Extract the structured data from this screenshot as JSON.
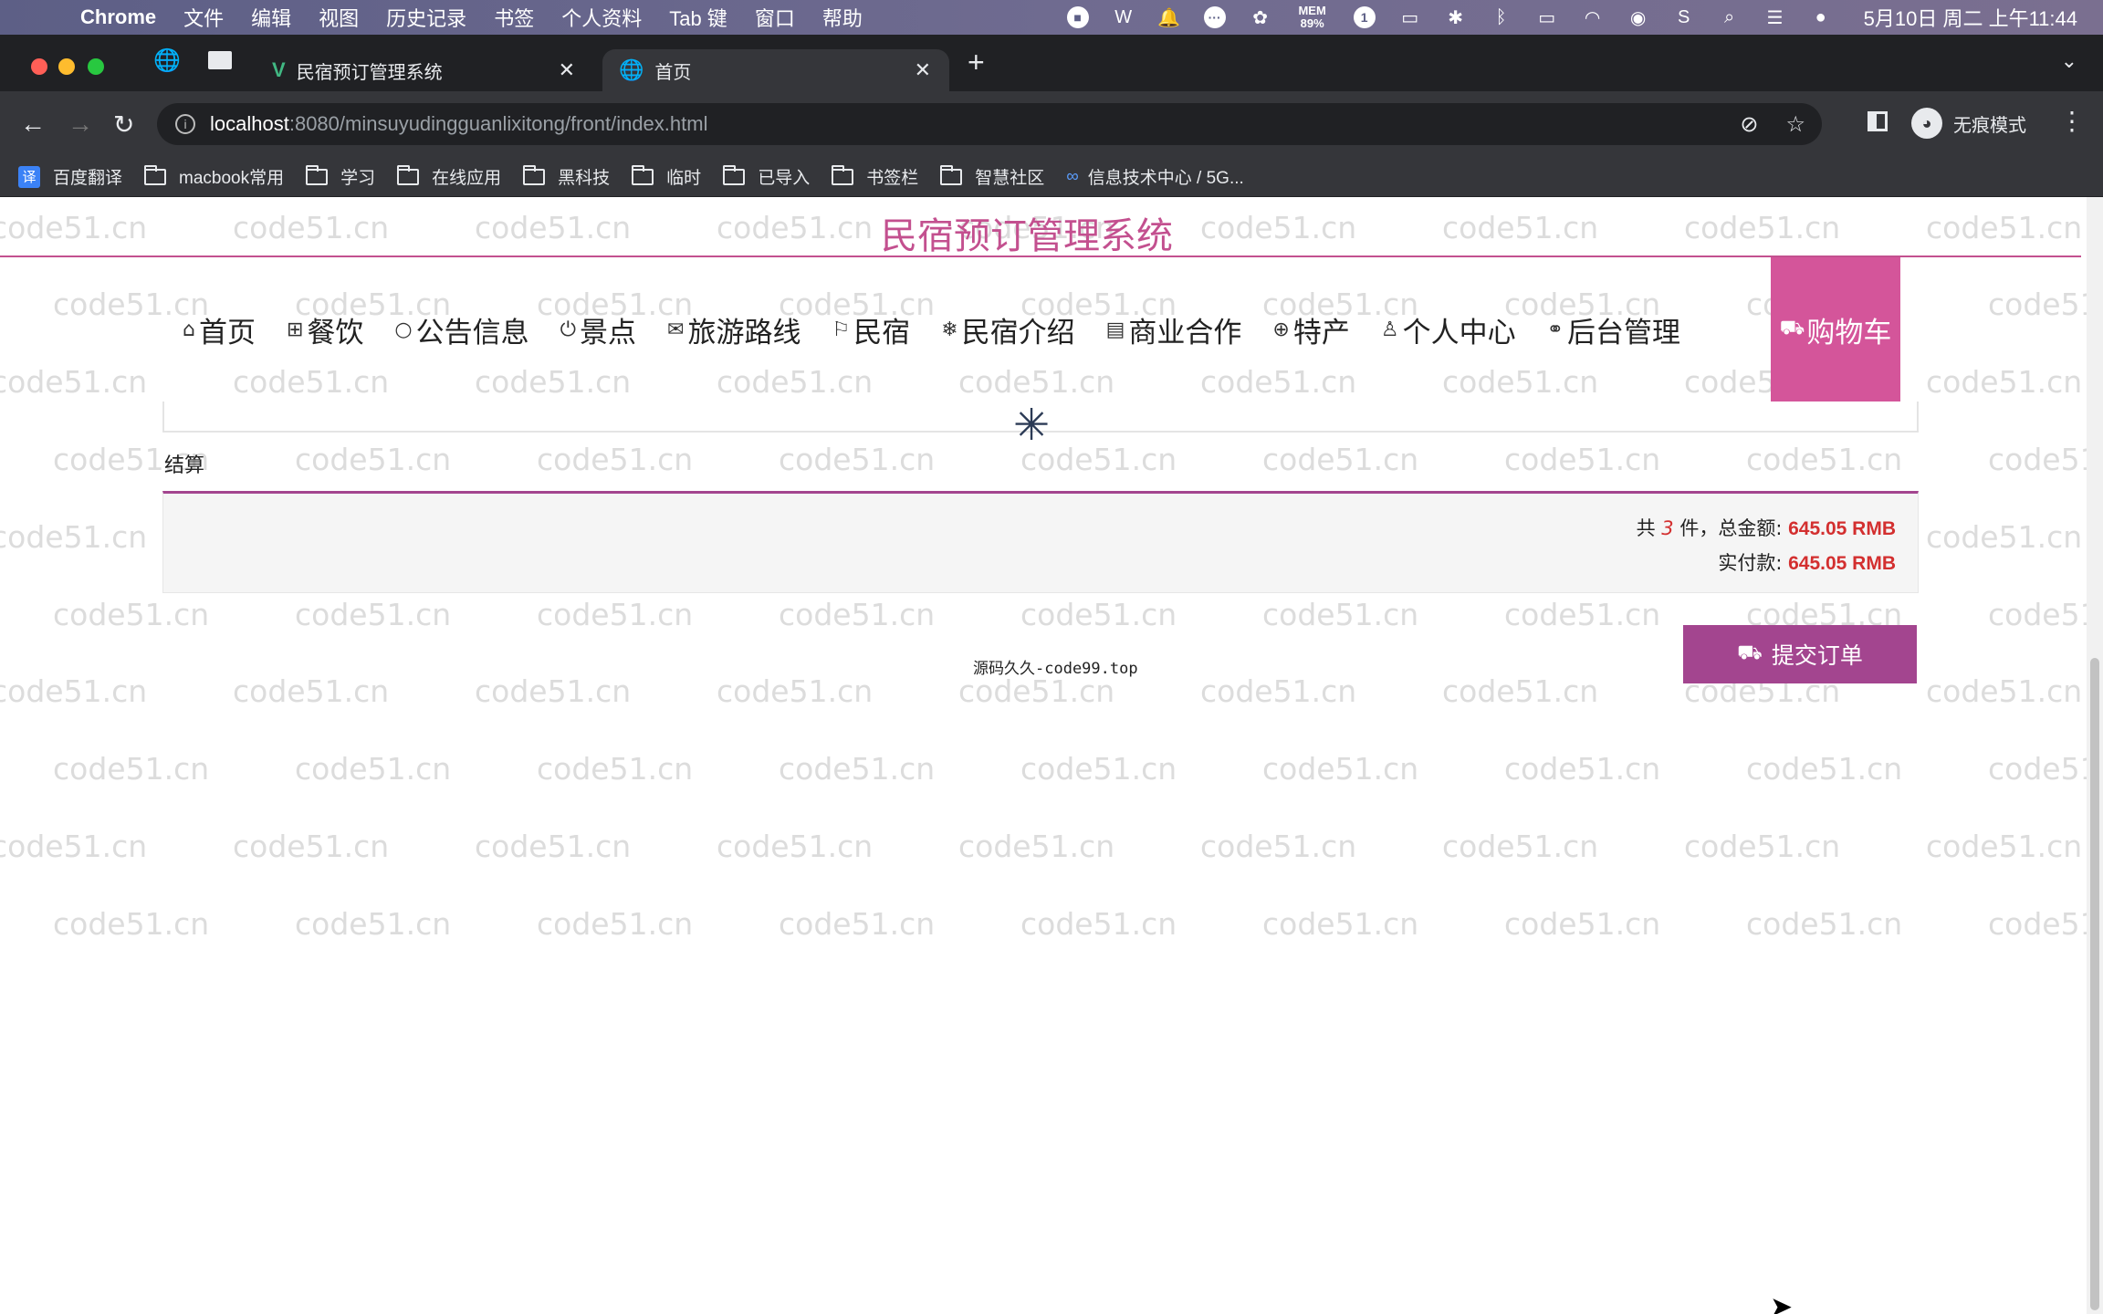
{
  "menubar": {
    "app": "Chrome",
    "items": [
      "文件",
      "编辑",
      "视图",
      "历史记录",
      "书签",
      "个人资料",
      "Tab 键",
      "窗口",
      "帮助"
    ],
    "mem_label": "MEM",
    "mem_value": "89%",
    "datetime": "5月10日 周二 上午11:44"
  },
  "tabs": [
    {
      "title": "民宿预订管理系统"
    },
    {
      "title": "首页"
    }
  ],
  "omnibox": {
    "host": "localhost",
    "path": ":8080/minsuyudingguanlixitong/front/index.html"
  },
  "incognito_label": "无痕模式",
  "bookmarks": [
    "百度翻译",
    "macbook常用",
    "学习",
    "在线应用",
    "黑科技",
    "临时",
    "已导入",
    "书签栏",
    "智慧社区",
    "信息技术中心 / 5G..."
  ],
  "site": {
    "title": "民宿预订管理系统",
    "nav": [
      {
        "label": "首页",
        "icon": "⌂"
      },
      {
        "label": "餐饮",
        "icon": "⊞"
      },
      {
        "label": "公告信息",
        "icon": "○"
      },
      {
        "label": "景点",
        "icon": "⏻"
      },
      {
        "label": "旅游路线",
        "icon": "✉"
      },
      {
        "label": "民宿",
        "icon": "⚐"
      },
      {
        "label": "民宿介绍",
        "icon": "❄"
      },
      {
        "label": "商业合作",
        "icon": "▤"
      },
      {
        "label": "特产",
        "icon": "⊕"
      },
      {
        "label": "个人中心",
        "icon": "♙"
      },
      {
        "label": "后台管理",
        "icon": "⚭"
      }
    ],
    "cart": {
      "label": "购物车",
      "icon": "🛒"
    }
  },
  "checkout": {
    "section_label": "结算",
    "count_prefix": "共",
    "count": "3",
    "count_suffix": "件，总金额:",
    "total": "645.05 RMB",
    "paid_label": "实付款:",
    "paid": "645.05 RMB",
    "submit_label": "提交订单"
  },
  "footer": "源码久久-code99.top",
  "watermark": "code51.cn"
}
